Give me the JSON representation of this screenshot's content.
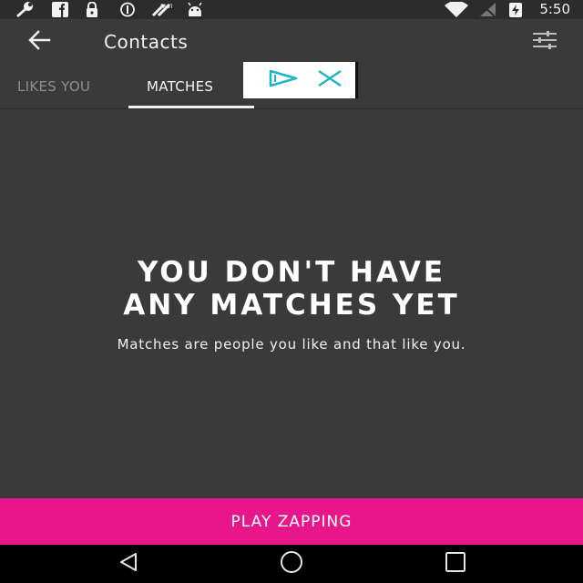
{
  "status_bar": {
    "time": "5:50",
    "icons": [
      "wrench-icon",
      "facebook-icon",
      "lock-icon",
      "sync-icon",
      "data-icon",
      "android-icon",
      "wifi-icon",
      "no-signal-icon",
      "battery-charging-icon"
    ]
  },
  "app_bar": {
    "title": "Contacts",
    "back_icon": "arrow-back-icon",
    "filter_icon": "sliders-icon"
  },
  "tabs": [
    {
      "label": "LIKES YOU",
      "active": false
    },
    {
      "label": "MATCHES",
      "active": true
    }
  ],
  "ad_badge": {
    "icons": [
      "play-outline-icon",
      "close-icon"
    ]
  },
  "empty_state": {
    "title_line1": "YOU DON'T HAVE",
    "title_line2": "ANY MATCHES YET",
    "subtitle": "Matches are people you like and that like you."
  },
  "cta": {
    "label": "PLAY ZAPPING"
  },
  "nav_bar": {
    "buttons": [
      "back-triangle-icon",
      "home-circle-icon",
      "recents-square-icon"
    ]
  },
  "colors": {
    "accent": "#e7168a",
    "background": "#3a3a3a",
    "status_bar": "#2c2c2c",
    "ad_icon": "#1fb5c9"
  }
}
